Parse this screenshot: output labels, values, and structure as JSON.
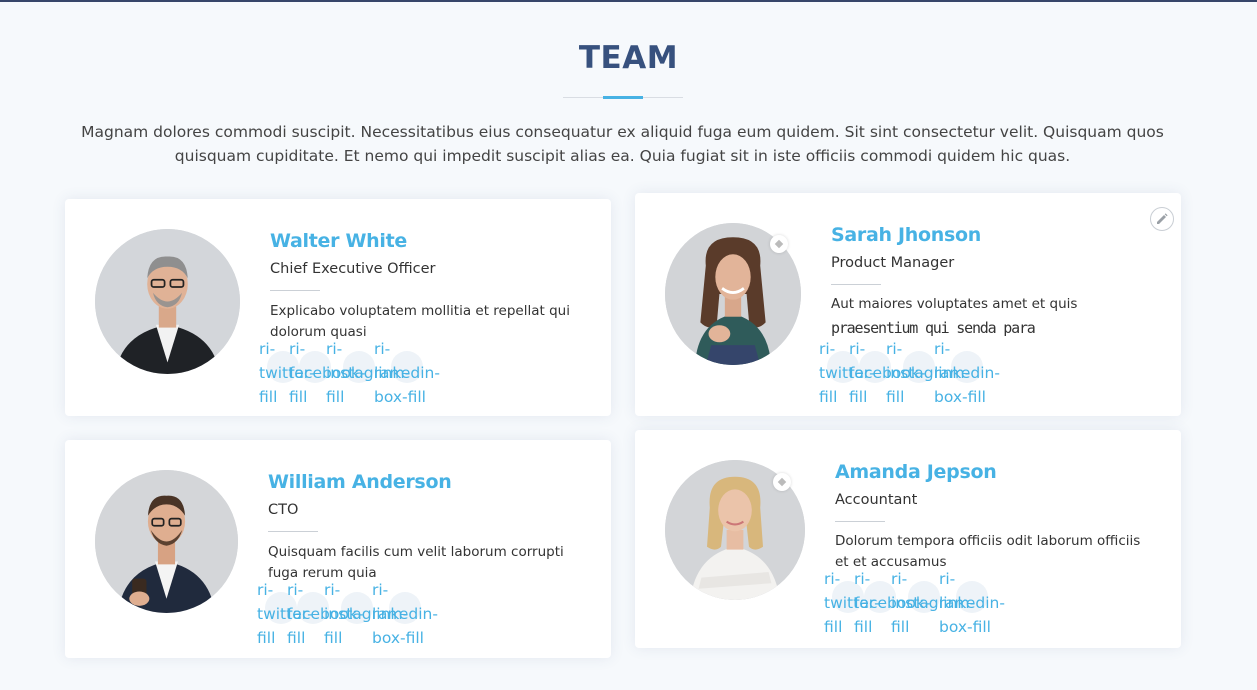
{
  "section": {
    "title": "TEAM",
    "description": "Magnam dolores commodi suscipit. Necessitatibus eius consequatur ex aliquid fuga eum quidem. Sit sint consectetur velit. Quisquam quos quisquam cupiditate. Et nemo qui impedit suscipit alias ea. Quia fugiat sit in iste officiis commodi quidem hic quas."
  },
  "colors": {
    "accent": "#47b2e4",
    "heading": "#37517e",
    "background": "#f6f9fc"
  },
  "members": [
    {
      "name": "Walter White",
      "role": "Chief Executive Officer",
      "bio": "Explicabo voluptatem mollitia et repellat qui dolorum quasi",
      "social": [
        "ri-\ntwitter-\nfill",
        "ri-\nfacebook-\nfill",
        "ri-\ninstagram-\nfill",
        "ri-\nlinkedin-\nbox-fill"
      ]
    },
    {
      "name": "Sarah Jhonson",
      "role": "Product Manager",
      "bio": "Aut maiores voluptates amet et quis",
      "bio_overflow": "praesentium qui senda para",
      "social": [
        "ri-\ntwitter-\nfill",
        "ri-\nfacebook-\nfill",
        "ri-\ninstagram-\nfill",
        "ri-\nlinkedin-\nbox-fill"
      ]
    },
    {
      "name": "William Anderson",
      "role": "CTO",
      "bio": "Quisquam facilis cum velit laborum corrupti fuga rerum quia",
      "social": [
        "ri-\ntwitter-\nfill",
        "ri-\nfacebook-\nfill",
        "ri-\ninstagram-\nfill",
        "ri-\nlinkedin-\nbox-fill"
      ]
    },
    {
      "name": "Amanda Jepson",
      "role": "Accountant",
      "bio": "Dolorum tempora officiis odit laborum officiis et et accusamus",
      "social": [
        "ri-\ntwitter-\nfill",
        "ri-\nfacebook-\nfill",
        "ri-\ninstagram-\nfill",
        "ri-\nlinkedin-\nbox-fill"
      ]
    }
  ],
  "icons": {
    "edit": "pencil-icon",
    "social": [
      "twitter-icon",
      "facebook-icon",
      "instagram-icon",
      "linkedin-icon"
    ]
  }
}
